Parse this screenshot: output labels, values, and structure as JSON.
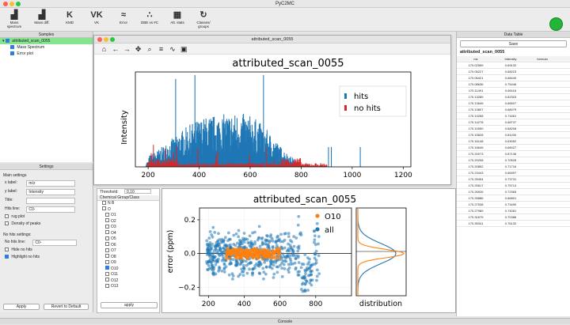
{
  "app": {
    "title": "PyC2MC"
  },
  "toolbar": [
    {
      "label": "Mass spectrum",
      "icon": "bar-chart-icon"
    },
    {
      "label": "Mass diff.",
      "icon": "bar-chart-icon"
    },
    {
      "label": "KMD",
      "icon": "k-icon"
    },
    {
      "label": "VK",
      "icon": "vk-icon"
    },
    {
      "label": "Error",
      "icon": "error-curve-icon"
    },
    {
      "label": "DBE vs #C",
      "icon": "scatter-icon"
    },
    {
      "label": "Att. stats",
      "icon": "stats-icon"
    },
    {
      "label": "Classes/ groups",
      "icon": "refresh-icon"
    }
  ],
  "samples": {
    "title": "Samples",
    "items": [
      {
        "label": "attributed_scan_0055",
        "checked": true
      },
      {
        "label": "Mass Spectrum",
        "checked": true
      },
      {
        "label": "Error plot",
        "checked": true
      }
    ]
  },
  "settings": {
    "title": "Settings",
    "main_label": "Main settings",
    "fields": [
      {
        "key": "x label:",
        "value": "m/z"
      },
      {
        "key": "y label:",
        "value": "Intensity"
      },
      {
        "key": "Title:",
        "value": ""
      },
      {
        "key": "Hits line:",
        "value": "C0-"
      }
    ],
    "checks": [
      "rug plot",
      "Density of peaks"
    ],
    "nohits_label": "No hits settings:",
    "nohits_field": {
      "key": "No hits line:",
      "value": "C0-"
    },
    "nohits_checks": [
      {
        "label": "Hide no hits",
        "checked": false
      },
      {
        "label": "Highlight no hits",
        "checked": true
      }
    ],
    "apply": "Apply",
    "revert": "Revert to Default"
  },
  "plot_window": {
    "title": "attributed_scan_0055"
  },
  "chem": {
    "threshold_label": "Threshold:",
    "threshold_value": "0,10",
    "header": "Chemical Group/Class",
    "items": [
      {
        "label": "N B",
        "checked": false
      },
      {
        "label": "O",
        "checked": false
      },
      {
        "label": "O1",
        "checked": false
      },
      {
        "label": "O2",
        "checked": false
      },
      {
        "label": "O3",
        "checked": false
      },
      {
        "label": "O4",
        "checked": false
      },
      {
        "label": "O5",
        "checked": false
      },
      {
        "label": "O6",
        "checked": false
      },
      {
        "label": "O7",
        "checked": false
      },
      {
        "label": "O8",
        "checked": false
      },
      {
        "label": "O9",
        "checked": false
      },
      {
        "label": "O10",
        "checked": true
      },
      {
        "label": "O11",
        "checked": false
      },
      {
        "label": "O12",
        "checked": false
      },
      {
        "label": "O13",
        "checked": false
      }
    ],
    "apply": "apply"
  },
  "data_table": {
    "title": "Data Table",
    "save": "Save",
    "sample": "attributed_scan_0055",
    "columns": [
      "mz",
      "Intensity",
      "formula"
    ],
    "rows": [
      [
        "170.02559",
        "0.69132"
      ],
      [
        "170.05227",
        "0.68223"
      ],
      [
        "170.06421",
        "0.68449"
      ],
      [
        "170.08636",
        "0.75446"
      ],
      [
        "170.11491",
        "0.66116"
      ],
      [
        "170.13289",
        "0.82303"
      ],
      [
        "170.13645",
        "0.66507"
      ],
      [
        "170.13807",
        "0.68079"
      ],
      [
        "170.14268",
        "0.71661"
      ],
      [
        "170.14278",
        "0.68737"
      ],
      [
        "170.10550",
        "0.68208"
      ],
      [
        "170.15828",
        "0.81030"
      ],
      [
        "170.16148",
        "0.63052"
      ],
      [
        "170.18645",
        "0.66027"
      ],
      [
        "170.20073",
        "0.87136"
      ],
      [
        "170.20208",
        "0.70526"
      ],
      [
        "170.20852",
        "0.71716"
      ],
      [
        "170.23443",
        "0.66997"
      ],
      [
        "170.25454",
        "0.73731"
      ],
      [
        "170.25817",
        "0.75714"
      ],
      [
        "170.26926",
        "0.72365"
      ],
      [
        "170.26886",
        "0.66801"
      ],
      [
        "170.27538",
        "0.73490"
      ],
      [
        "170.27989",
        "0.74081"
      ],
      [
        "170.31675",
        "0.70386"
      ],
      [
        "170.35341",
        "0.76132"
      ]
    ]
  },
  "console": {
    "title": "Console"
  },
  "chart_data": [
    {
      "type": "bar",
      "title": "attributed_scan_0055",
      "xlabel": "",
      "ylabel": "Intensity",
      "xlim": [
        150,
        1230
      ],
      "xticks": [
        200,
        400,
        600,
        800,
        1000,
        1200
      ],
      "series": [
        {
          "name": "hits",
          "color": "#1f77b4"
        },
        {
          "name": "no hits",
          "color": "#d62728"
        }
      ],
      "legend": "top-right"
    },
    {
      "type": "scatter",
      "title": "attributed_scan_0055",
      "xlabel": "",
      "ylabel": "error (ppm)",
      "xlim": [
        150,
        1000
      ],
      "ylim": [
        -0.25,
        0.27
      ],
      "xticks": [
        200,
        400,
        600,
        800
      ],
      "yticks": [
        -0.2,
        0.0,
        0.2
      ],
      "yticklabels": [
        "−0.2",
        "0.0",
        "0.2"
      ],
      "series": [
        {
          "name": "O10",
          "color": "#ff7f0e"
        },
        {
          "name": "all",
          "color": "#1f77b4"
        }
      ],
      "legend": "top-right",
      "side_panel_label": "distribution"
    }
  ]
}
